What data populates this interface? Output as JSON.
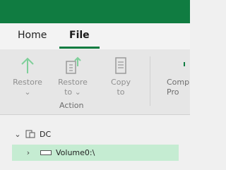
{
  "tabs": {
    "home": "Home",
    "file": "File"
  },
  "ribbon": {
    "restore": {
      "line1": "Restore",
      "icon": "arrow-up-icon"
    },
    "restore_to": {
      "line1": "Restore",
      "line2": "to",
      "icon": "document-arrow-up-icon"
    },
    "copy_to": {
      "line1": "Copy",
      "line2": "to",
      "icon": "document-icon"
    },
    "compare": {
      "line1": "Comp",
      "line2": "Pro"
    },
    "group_label": "Action"
  },
  "tree": {
    "root_label": "DC",
    "volume_label": "Volume0:\\"
  },
  "colors": {
    "accent": "#107c41",
    "selection": "#c5ecd2"
  }
}
